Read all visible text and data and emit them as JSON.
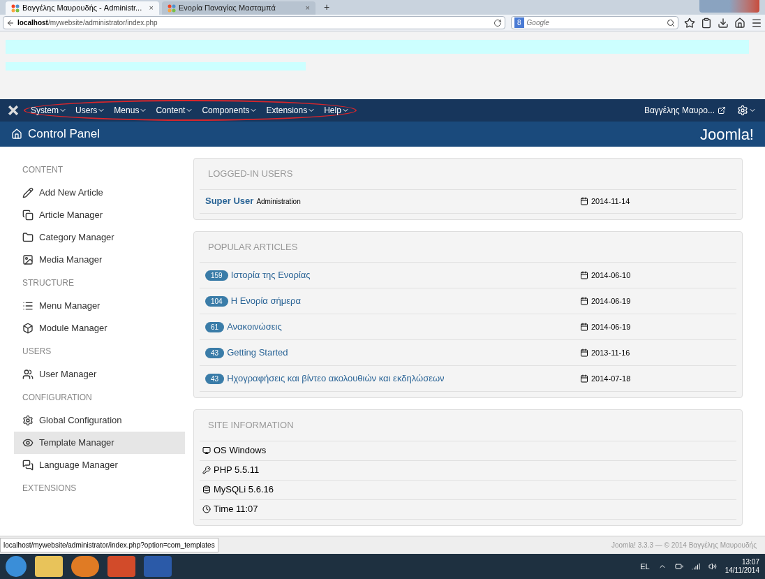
{
  "browser": {
    "tabs": [
      {
        "label": "Βαγγέλης Μαυρουδής - Administr...",
        "close": "×",
        "selected": true
      },
      {
        "label": "Ενορία Παναγίας Μασταμπά",
        "close": "×",
        "selected": false
      }
    ],
    "new_tab": "+",
    "url_host": "localhost",
    "url_path": "/mywebsite/administrator/index.php",
    "search_placeholder": "Google",
    "search_engine": "8"
  },
  "navbar": {
    "menus": [
      {
        "label": "System"
      },
      {
        "label": "Users"
      },
      {
        "label": "Menus"
      },
      {
        "label": "Content"
      },
      {
        "label": "Components"
      },
      {
        "label": "Extensions"
      },
      {
        "label": "Help"
      }
    ],
    "user": "Βαγγέλης Μαυρο..."
  },
  "header": {
    "title": "Control Panel",
    "logo": "Joomla!"
  },
  "sidebar": {
    "sections": [
      {
        "heading": "CONTENT",
        "items": [
          {
            "label": "Add New Article",
            "selected": false
          },
          {
            "label": "Article Manager",
            "selected": false
          },
          {
            "label": "Category Manager",
            "selected": false
          },
          {
            "label": "Media Manager",
            "selected": false
          }
        ]
      },
      {
        "heading": "STRUCTURE",
        "items": [
          {
            "label": "Menu Manager",
            "selected": false
          },
          {
            "label": "Module Manager",
            "selected": false
          }
        ]
      },
      {
        "heading": "USERS",
        "items": [
          {
            "label": "User Manager",
            "selected": false
          }
        ]
      },
      {
        "heading": "CONFIGURATION",
        "items": [
          {
            "label": "Global Configuration",
            "selected": false
          },
          {
            "label": "Template Manager",
            "selected": true
          },
          {
            "label": "Language Manager",
            "selected": false
          }
        ]
      },
      {
        "heading": "EXTENSIONS"
      }
    ]
  },
  "logged_in_users": {
    "title": "LOGGED-IN USERS",
    "rows": [
      {
        "name": "Super User",
        "area": "Administration",
        "date": "2014-11-14"
      }
    ]
  },
  "popular_articles": {
    "title": "POPULAR ARTICLES",
    "rows": [
      {
        "hits": "159",
        "title": "Ιστορία της Ενορίας",
        "date": "2014-06-10"
      },
      {
        "hits": "104",
        "title": "Η Ενορία σήμερα",
        "date": "2014-06-19"
      },
      {
        "hits": "61",
        "title": "Ανακοινώσεις",
        "date": "2014-06-19"
      },
      {
        "hits": "43",
        "title": "Getting Started",
        "date": "2013-11-16"
      },
      {
        "hits": "43",
        "title": "Ηχογραφήσεις και βίντεο ακολουθιών και εκδηλώσεων",
        "date": "2014-07-18"
      }
    ]
  },
  "site_information": {
    "title": "SITE INFORMATION",
    "rows": [
      {
        "text": "OS Windows"
      },
      {
        "text": "PHP 5.5.11"
      },
      {
        "text": "MySQLi 5.6.16"
      },
      {
        "text": "Time 11:07"
      }
    ]
  },
  "status_url": "localhost/mywebsite/administrator/index.php?option=com_templates",
  "footer": "Joomla! 3.3.3 — © 2014 Βαγγέλης Μαυρουδής",
  "taskbar": {
    "lang": "EL",
    "time": "13:07",
    "date": "14/11/2014"
  }
}
